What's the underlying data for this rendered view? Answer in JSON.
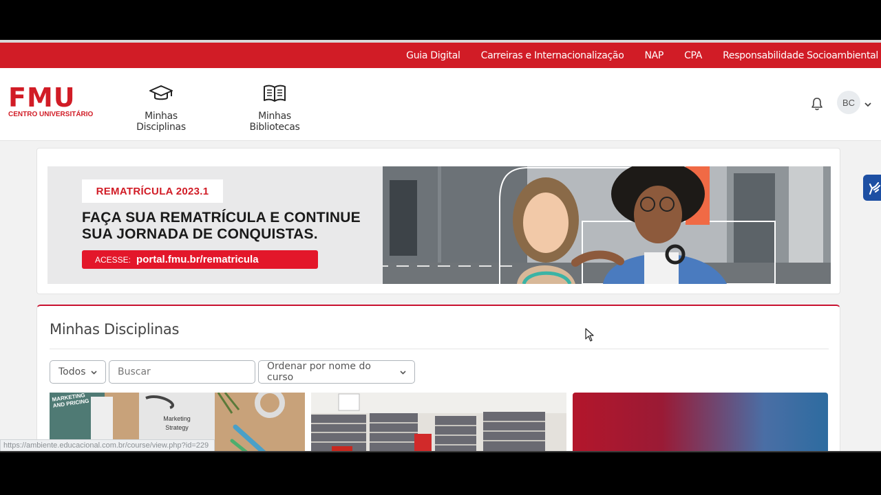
{
  "topbar": {
    "links": [
      "Guia Digital",
      "Carreiras e Internacionalização",
      "NAP",
      "CPA",
      "Responsabilidade Socioambiental"
    ]
  },
  "logo": {
    "main": "FMU",
    "sub": "CENTRO UNIVERSITÁRIO"
  },
  "nav": {
    "disciplinas": {
      "label": "Minhas Disciplinas",
      "icon": "graduation-cap-icon"
    },
    "bibliotecas": {
      "label": "Minhas Bibliotecas",
      "icon": "book-icon"
    }
  },
  "user": {
    "initials": "BC"
  },
  "banner": {
    "tag": "REMATRÍCULA 2023.1",
    "headline_line1": "FAÇA SUA REMATRÍCULA E CONTINUE",
    "headline_line2": "SUA JORNADA DE CONQUISTAS.",
    "link_prefix": "ACESSE:",
    "link_url": "portal.fmu.br/rematricula"
  },
  "courses": {
    "title": "Minhas Disciplinas",
    "filter": "Todos",
    "search_placeholder": "Buscar",
    "sort": "Ordenar por nome do curso",
    "card1_book_title": "MARKETING AND PRICING",
    "card1_note": "Marketing Strategy"
  },
  "status_url": "https://ambiente.educacional.com.br/course/view.php?id=229",
  "colors": {
    "brand_red": "#d11c26",
    "accessibility_blue": "#1d4fa3"
  }
}
